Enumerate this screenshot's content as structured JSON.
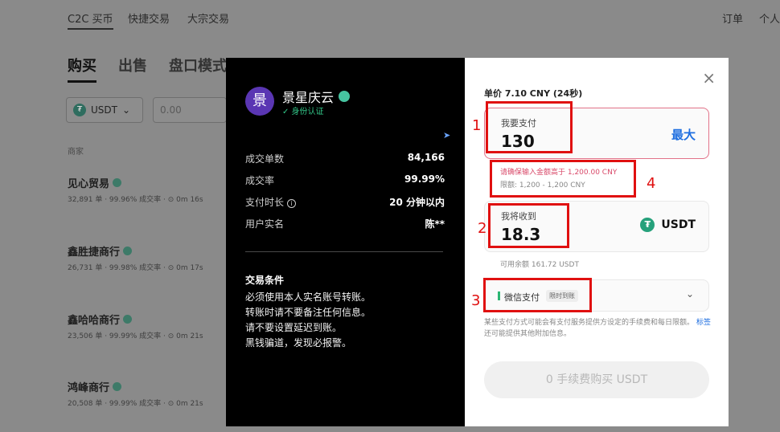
{
  "background": {
    "nav": [
      "C2C 买币",
      "快捷交易",
      "大宗交易"
    ],
    "top_right": [
      "订单",
      "个人"
    ],
    "tabs": [
      "购买",
      "出售",
      "盘口模式"
    ],
    "coin_select": "USDT",
    "amount_placeholder": "0.00",
    "column_header": "商家",
    "merchants": [
      {
        "name": "见心贸易",
        "stats": "32,891 单 · 99.96% 成交率 · ⊙ 0m 16s"
      },
      {
        "name": "鑫胜捷商行",
        "stats": "26,731 单 · 99.98% 成交率 · ⊙ 0m 17s"
      },
      {
        "name": "鑫哈哈商行",
        "stats": "23,506 单 · 99.99% 成交率 · ⊙ 0m 21s"
      },
      {
        "name": "鸿峰商行",
        "stats": "20,508 单 · 99.99% 成交率 · ⊙ 0m 21s"
      }
    ]
  },
  "seller": {
    "avatar_char": "景",
    "name": "景星庆云",
    "verified": "✓ 身份认证",
    "stats": [
      {
        "label": "成交单数",
        "value": "84,166"
      },
      {
        "label": "成交率",
        "value": "99.99%"
      },
      {
        "label": "支付时长",
        "value": "20 分钟以内"
      },
      {
        "label": "用户实名",
        "value": "陈**"
      }
    ],
    "terms_title": "交易条件",
    "terms": [
      "必须使用本人实名账号转账。",
      "转账时请不要备注任何信息。",
      "请不要设置延迟到账。",
      "黑钱骗道，发现必报警。"
    ]
  },
  "order": {
    "close": "×",
    "unit_price": "单价 7.10 CNY (24秒)",
    "pay_label": "我要支付",
    "pay_value": "130",
    "pay_max": "最大",
    "error_text": "请确保输入金额高于 1,200.00 CNY",
    "limit_text": "限额: 1,200 - 1,200 CNY",
    "receive_label": "我将收到",
    "receive_value": "18.3",
    "receive_coin": "USDT",
    "available": "可用余额 161.72 USDT",
    "method_name": "微信支付",
    "method_tag": "限时到账",
    "note_text": "某些支付方式可能会有支付服务提供方设定的手续费和每日限额。",
    "note_link": "标签",
    "note_rest": "还可能提供其他附加信息。",
    "buy_button": "0 手续费购买 USDT"
  },
  "annotations": [
    "1",
    "2",
    "3",
    "4"
  ],
  "colors": {
    "accent_blue": "#1f6fe0",
    "error_red": "#d94a6a",
    "annotation_red": "#e01010",
    "tether_green": "#26a17b"
  }
}
